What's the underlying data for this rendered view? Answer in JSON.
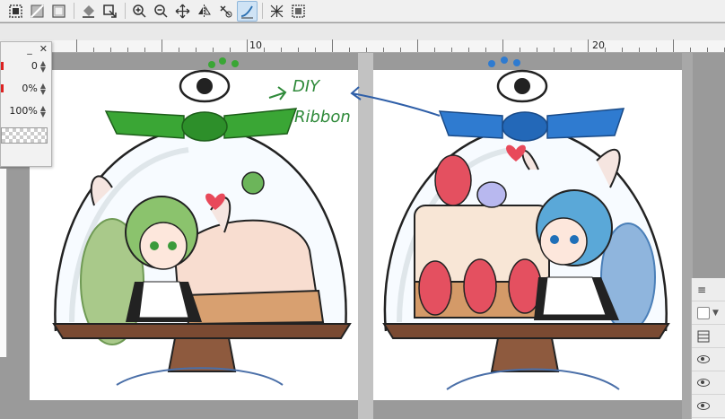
{
  "toolbar": {
    "icons": [
      "select-layer-icon",
      "select-area-icon",
      "deselect-icon",
      "fill-icon",
      "transform-icon",
      "zoom-in-icon",
      "zoom-out-icon",
      "move-icon",
      "flip-icon",
      "rotate-icon",
      "stabilizer-icon",
      "ruler-icon",
      "snap-icon"
    ],
    "active": "stabilizer-icon"
  },
  "ruler": {
    "label_10": "10",
    "label_20": "20"
  },
  "tool_property": {
    "row1_value": "0",
    "row2_value": "0%",
    "row3_value": "100%"
  },
  "canvas": {
    "annotation_line1": "DIY",
    "annotation_line2": "Ribbon"
  },
  "colors": {
    "green_ribbon": "#3aa635",
    "blue_ribbon": "#2f7bd0",
    "wood": "#7a4a32",
    "annotation": "#2f8a3a"
  }
}
